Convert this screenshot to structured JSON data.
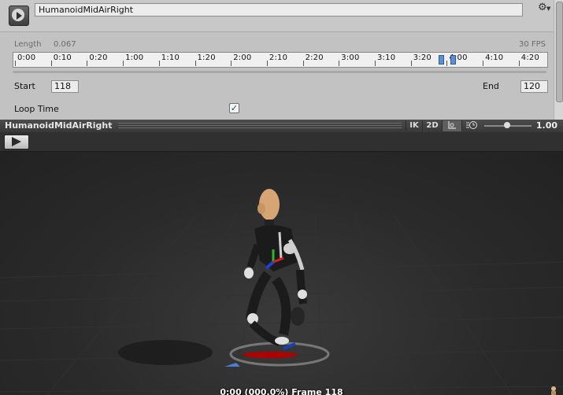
{
  "clip": {
    "name": "HumanoidMidAirRight",
    "length_label": "Length",
    "length_value": "0.067",
    "fps": "30 FPS",
    "timeline_labels": [
      "0:00",
      "0:10",
      "0:20",
      "1:00",
      "1:10",
      "1:20",
      "2:00",
      "2:10",
      "2:20",
      "3:00",
      "3:10",
      "3:20",
      "4:00",
      "4:10",
      "4:20"
    ],
    "start_label": "Start",
    "start_value": "118",
    "end_label": "End",
    "end_value": "120",
    "loop_time_label": "Loop Time",
    "loop_time_checked": true
  },
  "preview": {
    "title": "HumanoidMidAirRight",
    "ik_label": "IK",
    "twod_label": "2D",
    "pivot_icon": "pivot-icon",
    "speed_icon": "speed-icon",
    "speed_value": "1.00",
    "status": "0:00 (000.0%) Frame 118"
  },
  "colors": {
    "accent": "#5b8fd6",
    "panel": "#c2c2c2",
    "viewport": "#262626"
  }
}
